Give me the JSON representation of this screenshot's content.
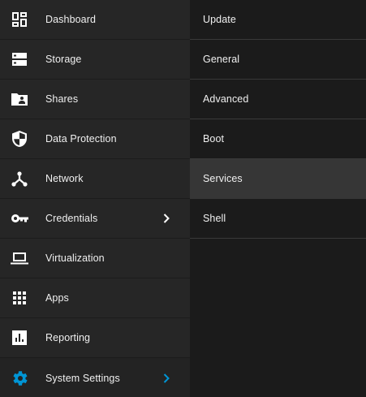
{
  "sidebar": {
    "items": [
      {
        "label": "Dashboard",
        "icon": "dashboard-icon"
      },
      {
        "label": "Storage",
        "icon": "storage-icon"
      },
      {
        "label": "Shares",
        "icon": "shared-folder-icon"
      },
      {
        "label": "Data Protection",
        "icon": "shield-icon"
      },
      {
        "label": "Network",
        "icon": "network-hub-icon"
      },
      {
        "label": "Credentials",
        "icon": "key-icon"
      },
      {
        "label": "Virtualization",
        "icon": "laptop-icon"
      },
      {
        "label": "Apps",
        "icon": "apps-grid-icon"
      },
      {
        "label": "Reporting",
        "icon": "bar-chart-icon"
      },
      {
        "label": "System Settings",
        "icon": "gear-icon"
      }
    ]
  },
  "submenu": {
    "items": [
      {
        "label": "Update"
      },
      {
        "label": "General"
      },
      {
        "label": "Advanced"
      },
      {
        "label": "Boot"
      },
      {
        "label": "Services"
      },
      {
        "label": "Shell"
      }
    ]
  },
  "colors": {
    "accent": "#0095d5",
    "icon": "#ffffff",
    "sidebar_bg": "#262626",
    "submenu_bg": "#1b1b1b",
    "submenu_active_bg": "#363636"
  }
}
